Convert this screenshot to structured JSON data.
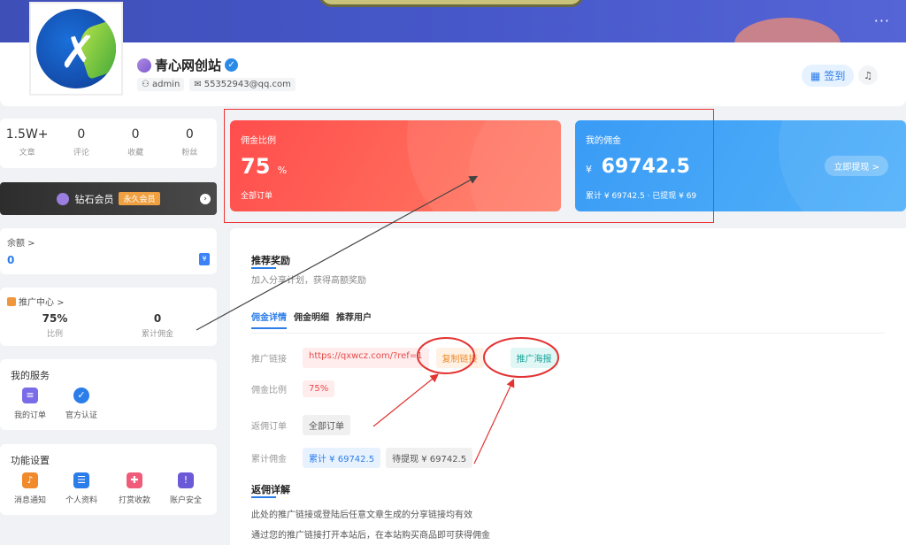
{
  "banner": {
    "more": "···"
  },
  "profile": {
    "site_name": "青心网创站",
    "username": "admin",
    "email": "55352943@qq.com",
    "checkin_label": "签到"
  },
  "stats": [
    {
      "value": "1.5W+",
      "label": "文章"
    },
    {
      "value": "0",
      "label": "评论"
    },
    {
      "value": "0",
      "label": "收藏"
    },
    {
      "value": "0",
      "label": "粉丝"
    }
  ],
  "vip": {
    "label": "钻石会员",
    "badge": "永久会员"
  },
  "balance": {
    "title": "余额 >",
    "value": "0"
  },
  "promo": {
    "title": "推广中心 >",
    "ratio_value": "75%",
    "ratio_label": "比例",
    "total_value": "0",
    "total_label": "累计佣金"
  },
  "service": {
    "title": "我的服务",
    "items": [
      {
        "label": "我的订单"
      },
      {
        "label": "官方认证"
      }
    ]
  },
  "settings": {
    "title": "功能设置",
    "items": [
      {
        "label": "消息通知"
      },
      {
        "label": "个人资料"
      },
      {
        "label": "打赏收款"
      },
      {
        "label": "账户安全"
      }
    ]
  },
  "commission_card": {
    "title": "佣金比例",
    "value": "75",
    "unit": "%",
    "subtitle": "全部订单"
  },
  "my_commission_card": {
    "title": "我的佣金",
    "currency": "¥",
    "value": "69742.5",
    "summary": "累计 ¥ 69742.5 · 已提现 ¥ 69",
    "withdraw_label": "立即提现 >"
  },
  "main": {
    "section_title": "推荐奖励",
    "section_sub": "加入分享计划，获得高额奖励",
    "tabs": [
      "佣金详情",
      "佣金明细",
      "推荐用户"
    ],
    "rows": {
      "link_label": "推广链接",
      "link_value": "https://qxwcz.com/?ref=1",
      "copy_label": "复制链接",
      "poster_label": "推广海报",
      "ratio_label": "佣金比例",
      "ratio_value": "75%",
      "orders_label": "返佣订单",
      "orders_value": "全部订单",
      "total_label": "累计佣金",
      "total_value": "累计 ¥ 69742.5",
      "pending_value": "待提现 ¥ 69742.5"
    },
    "detail_title": "返佣详解",
    "detail_lines": [
      "此处的推广链接或登陆后任意文章生成的分享链接均有效",
      "通过您的推广链接打开本站后，在本站购买商品即可获得佣金"
    ]
  },
  "colors": {
    "accent": "#2b7de9",
    "red_card": "#ff4d4d",
    "blue_card": "#3a9bf5",
    "annotation": "#e33333"
  }
}
